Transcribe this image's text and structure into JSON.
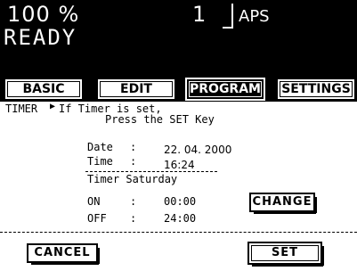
{
  "header": {
    "zoom": "100  %",
    "copies": "1",
    "paper": "APS",
    "status": "READY"
  },
  "tabs": [
    {
      "label": "BASIC"
    },
    {
      "label": "EDIT"
    },
    {
      "label": "PROGRAM"
    },
    {
      "label": "SETTINGS"
    }
  ],
  "timer": {
    "title": "TIMER",
    "message_line1": "If Timer is set,",
    "message_line2": "Press the SET Key",
    "date_label": "Date",
    "date_value": "22. 04. 2000",
    "time_label": "Time",
    "time_value": "16:24",
    "schedule_title": "Timer Saturday",
    "on_label": "ON",
    "on_value": "00:00",
    "off_label": "OFF",
    "off_value": "24:00",
    "colon": ":"
  },
  "buttons": {
    "change": "CHANGE",
    "cancel": "CANCEL",
    "set": "SET"
  }
}
